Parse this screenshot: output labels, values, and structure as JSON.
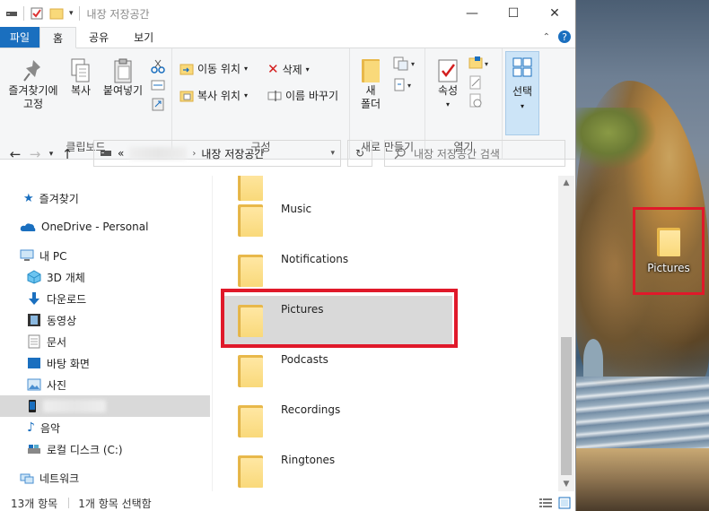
{
  "window": {
    "title": "내장 저장공간",
    "minimize_glyph": "—",
    "maximize_glyph": "☐",
    "close_glyph": "✕"
  },
  "tabs": [
    {
      "label": "파일"
    },
    {
      "label": "홈"
    },
    {
      "label": "공유"
    },
    {
      "label": "보기"
    }
  ],
  "ribbon": {
    "clipboard": {
      "pin_label": "즐겨찾기에\n고정",
      "copy_label": "복사",
      "paste_label": "붙여넣기",
      "group_label": "클립보드"
    },
    "organize": {
      "move_label": "이동 위치",
      "copy_to_label": "복사 위치",
      "delete_label": "삭제",
      "rename_label": "이름 바꾸기",
      "group_label": "구성"
    },
    "new": {
      "new_folder_label": "새\n폴더",
      "group_label": "새로 만들기"
    },
    "open": {
      "properties_label": "속성",
      "group_label": "열기"
    },
    "select": {
      "select_label": "선택"
    }
  },
  "navbar": {
    "address_prefix": "«",
    "address_current": "내장 저장공간",
    "search_placeholder": "내장 저장공간 검색"
  },
  "sidebar": {
    "items": [
      {
        "label": "즐겨찾기"
      },
      {
        "label": "OneDrive - Personal"
      },
      {
        "label": "내 PC"
      },
      {
        "label": "3D 개체"
      },
      {
        "label": "다운로드"
      },
      {
        "label": "동영상"
      },
      {
        "label": "문서"
      },
      {
        "label": "바탕 화면"
      },
      {
        "label": "사진"
      },
      {
        "label": ""
      },
      {
        "label": "음악"
      },
      {
        "label": "로컬 디스크 (C:)"
      },
      {
        "label": "네트워크"
      }
    ]
  },
  "files": [
    {
      "name": "Music"
    },
    {
      "name": "Notifications"
    },
    {
      "name": "Pictures"
    },
    {
      "name": "Podcasts"
    },
    {
      "name": "Recordings"
    },
    {
      "name": "Ringtones"
    }
  ],
  "status": {
    "item_count": "13개 항목",
    "selected_count": "1개 항목 선택함"
  },
  "desktop": {
    "icon_label": "Pictures"
  }
}
